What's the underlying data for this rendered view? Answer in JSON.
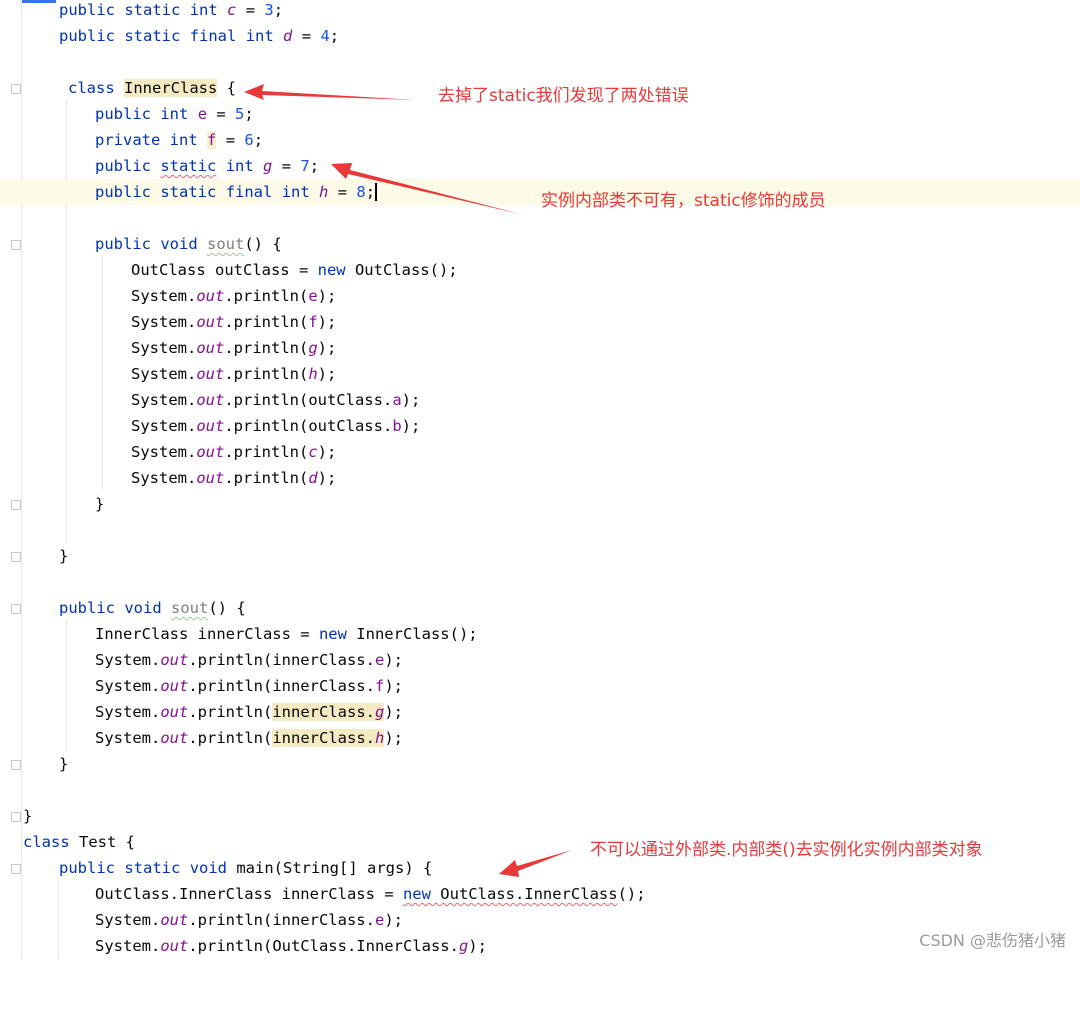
{
  "editor": {
    "lines": {
      "l0": {
        "kw1": "public",
        "kw2": "static",
        "kw3": "int",
        "name": "c",
        "op": " = ",
        "val": "3",
        "end": ";"
      },
      "l1": {
        "kw1": "public",
        "kw2": "static",
        "kw3": "final",
        "kw4": "int",
        "name": "d",
        "op": " = ",
        "val": "4",
        "end": ";"
      },
      "l3": {
        "kw1": "class",
        "name": "InnerClass",
        "rest": " {"
      },
      "l4": {
        "kw1": "public",
        "kw2": "int",
        "name": "e",
        "op": " = ",
        "val": "5",
        "end": ";"
      },
      "l5": {
        "kw1": "private",
        "kw2": "int",
        "name": "f",
        "op": " = ",
        "val": "6",
        "end": ";"
      },
      "l6": {
        "kw1": "public",
        "kw2": "static",
        "kw3": "int",
        "name": "g",
        "op": " = ",
        "val": "7",
        "end": ";"
      },
      "l7": {
        "kw1": "public",
        "kw2": "static",
        "kw3": "final",
        "kw4": "int",
        "name": "h",
        "op": " = ",
        "val": "8",
        "end": ";"
      },
      "l9": {
        "kw1": "public",
        "kw2": "void",
        "name": "sout",
        "rest": "() {"
      },
      "l10": {
        "a": "OutClass outClass = ",
        "kw": "new",
        "b": " OutClass();"
      },
      "l11": {
        "a": "System.",
        "out": "out",
        "b": ".println(",
        "arg": "e",
        "c": ");"
      },
      "l12": {
        "a": "System.",
        "out": "out",
        "b": ".println(",
        "arg": "f",
        "c": ");"
      },
      "l13": {
        "a": "System.",
        "out": "out",
        "b": ".println(",
        "arg": "g",
        "c": ");"
      },
      "l14": {
        "a": "System.",
        "out": "out",
        "b": ".println(",
        "arg": "h",
        "c": ");"
      },
      "l15": {
        "a": "System.",
        "out": "out",
        "b": ".println(outClass.",
        "arg": "a",
        "c": ");"
      },
      "l16": {
        "a": "System.",
        "out": "out",
        "b": ".println(outClass.",
        "arg": "b",
        "c": ");"
      },
      "l17": {
        "a": "System.",
        "out": "out",
        "b": ".println(",
        "arg": "c",
        "c": ");"
      },
      "l18": {
        "a": "System.",
        "out": "out",
        "b": ".println(",
        "arg": "d",
        "c": ");"
      },
      "l19": {
        "text": "}"
      },
      "l21": {
        "text": "}"
      },
      "l23": {
        "kw1": "public",
        "kw2": "void",
        "name": "sout",
        "rest": "() {"
      },
      "l24": {
        "a": "InnerClass innerClass = ",
        "kw": "new",
        "b": " InnerClass();"
      },
      "l25": {
        "a": "System.",
        "out": "out",
        "b": ".println(innerClass.",
        "arg": "e",
        "c": ");"
      },
      "l26": {
        "a": "System.",
        "out": "out",
        "b": ".println(innerClass.",
        "arg": "f",
        "c": ");"
      },
      "l27": {
        "a": "System.",
        "out": "out",
        "b": ".println(",
        "hl": "innerClass.",
        "arg": "g",
        "c": ");"
      },
      "l28": {
        "a": "System.",
        "out": "out",
        "b": ".println(",
        "hl": "innerClass.",
        "arg": "h",
        "c": ");"
      },
      "l29": {
        "text": "}"
      },
      "l31": {
        "text": "}"
      },
      "l32": {
        "kw1": "class",
        "rest": " Test {"
      },
      "l33": {
        "kw1": "public",
        "kw2": "static",
        "kw3": "void",
        "rest": " main(String[] args) {"
      },
      "l34": {
        "a": "OutClass.InnerClass innerClass = ",
        "kw": "new",
        "b": " OutClass.InnerClass",
        "c": "();"
      },
      "l35": {
        "a": "System.",
        "out": "out",
        "b": ".println(innerClass.",
        "arg": "e",
        "c": ");"
      },
      "l36": {
        "a": "System.",
        "out": "out",
        "b": ".println(OutClass.InnerClass.",
        "arg": "g",
        "c": ");"
      }
    }
  },
  "annotations": {
    "remove_static": "去掉了static我们发现了两处错误",
    "no_static_members": "实例内部类不可有，static修饰的成员",
    "no_instantiate": "不可以通过外部类.内部类()去实例化实例内部类对象"
  },
  "watermark": "CSDN @悲伤猪小猪",
  "colors": {
    "keyword": "#0033b3",
    "field": "#871094",
    "number": "#1750eb",
    "annotation": "#e8393a",
    "highlight": "#f5eac1"
  }
}
